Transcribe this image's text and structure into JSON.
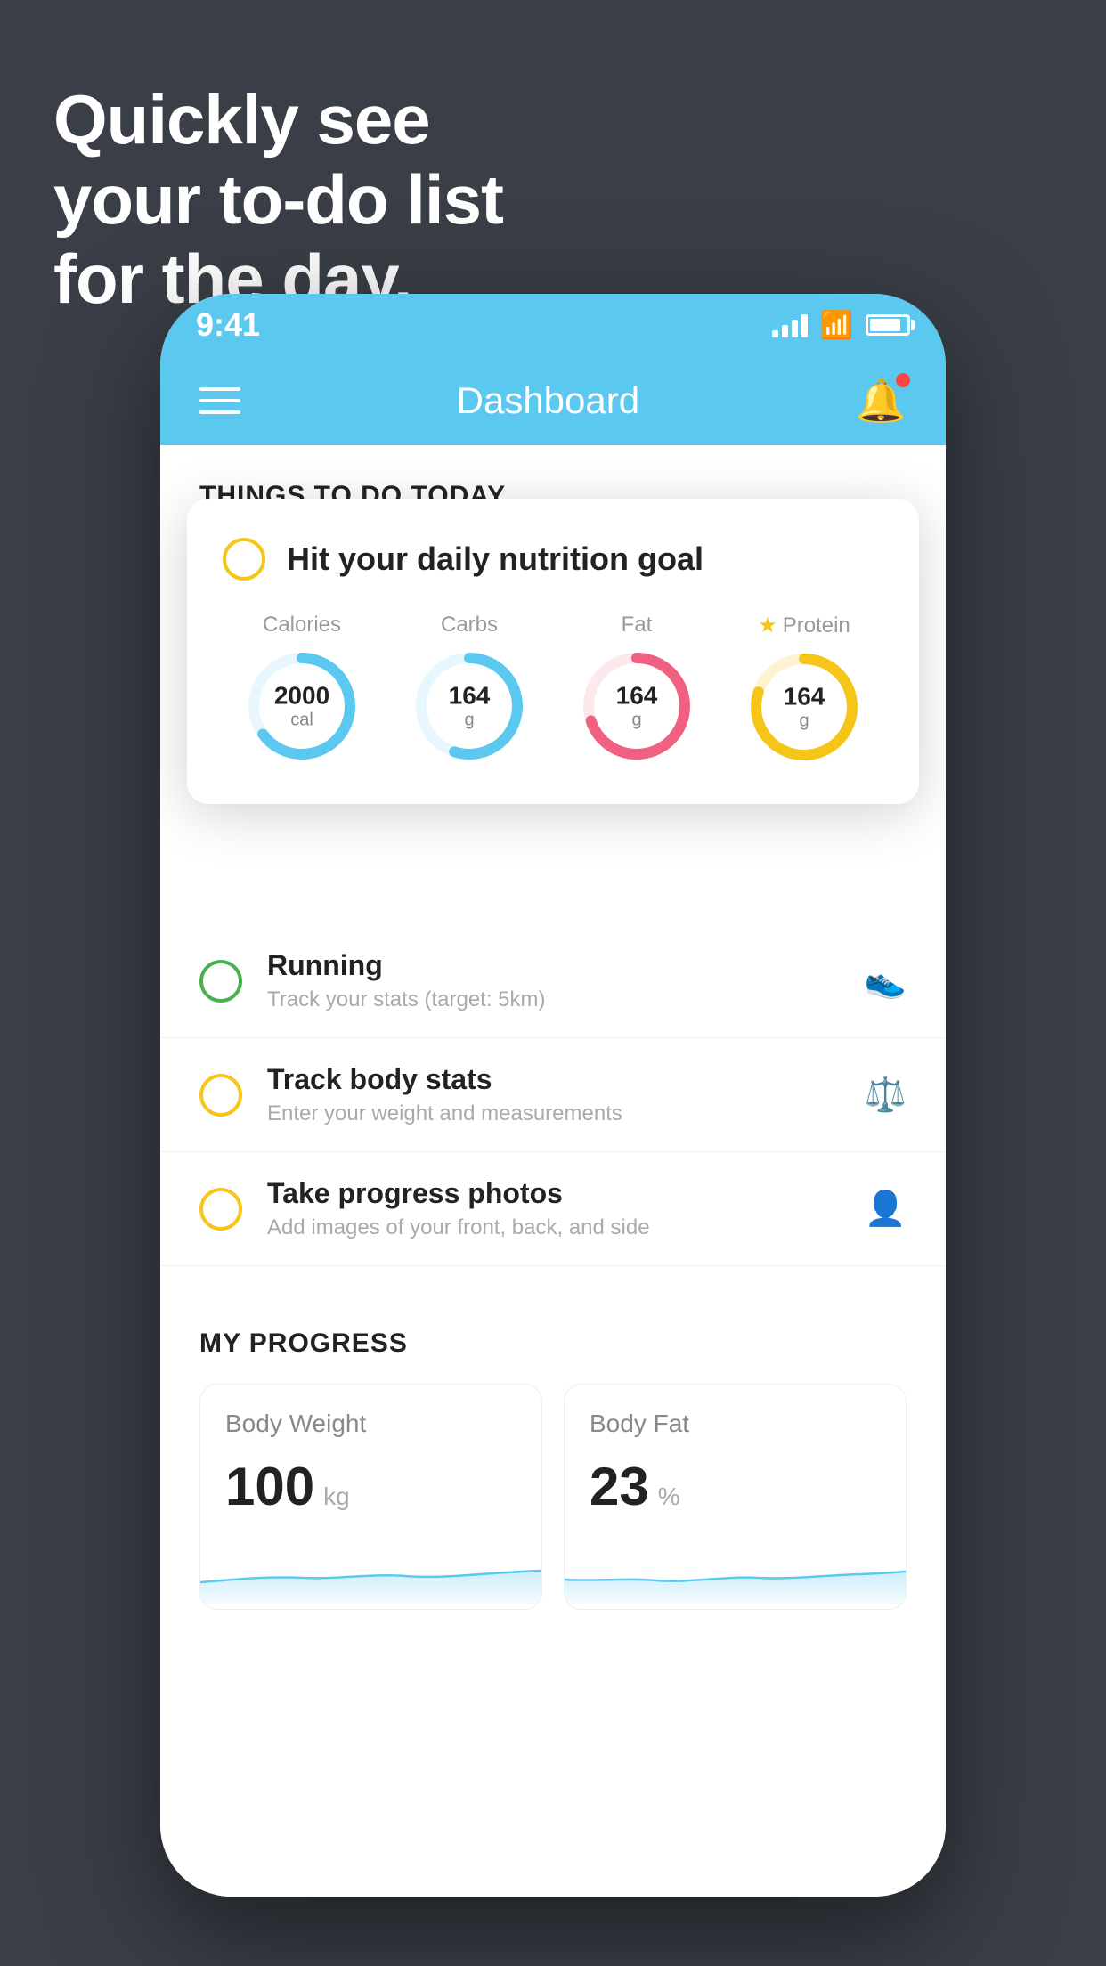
{
  "headline": {
    "line1": "Quickly see",
    "line2": "your to-do list",
    "line3": "for the day."
  },
  "status_bar": {
    "time": "9:41"
  },
  "header": {
    "title": "Dashboard"
  },
  "things_today": {
    "section_title": "THINGS TO DO TODAY"
  },
  "nutrition_card": {
    "title": "Hit your daily nutrition goal",
    "items": [
      {
        "label": "Calories",
        "value": "2000",
        "unit": "cal",
        "color": "#5bc8f0",
        "pct": 65,
        "star": false
      },
      {
        "label": "Carbs",
        "value": "164",
        "unit": "g",
        "color": "#5bc8f0",
        "pct": 55,
        "star": false
      },
      {
        "label": "Fat",
        "value": "164",
        "unit": "g",
        "color": "#f06080",
        "pct": 70,
        "star": false
      },
      {
        "label": "Protein",
        "value": "164",
        "unit": "g",
        "color": "#f5c518",
        "pct": 80,
        "star": true
      }
    ]
  },
  "todo_items": [
    {
      "title": "Running",
      "subtitle": "Track your stats (target: 5km)",
      "circle_color": "green",
      "icon": "🥿"
    },
    {
      "title": "Track body stats",
      "subtitle": "Enter your weight and measurements",
      "circle_color": "yellow",
      "icon": "⚖"
    },
    {
      "title": "Take progress photos",
      "subtitle": "Add images of your front, back, and side",
      "circle_color": "yellow",
      "icon": "👤"
    }
  ],
  "progress": {
    "section_title": "MY PROGRESS",
    "cards": [
      {
        "title": "Body Weight",
        "value": "100",
        "unit": "kg"
      },
      {
        "title": "Body Fat",
        "value": "23",
        "unit": "%"
      }
    ]
  }
}
